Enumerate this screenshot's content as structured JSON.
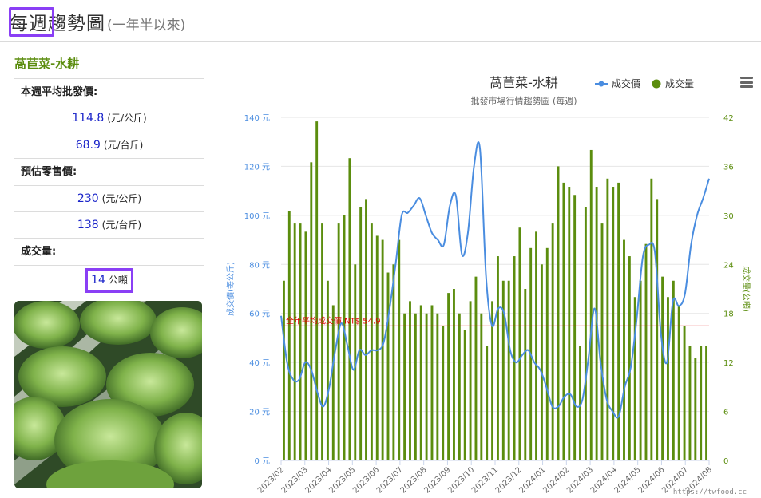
{
  "header": {
    "title": "每週趨勢圖",
    "subtitle": "(一年半以來)"
  },
  "sidebar": {
    "product": "萵苣菜-水耕",
    "wholesale_label": "本週平均批發價:",
    "wholesale_kg": "114.8",
    "wholesale_kg_unit": "(元/公斤)",
    "wholesale_tai": "68.9",
    "wholesale_tai_unit": "(元/台斤)",
    "retail_label": "預估零售價:",
    "retail_kg": "230",
    "retail_kg_unit": "(元/公斤)",
    "retail_tai": "138",
    "retail_tai_unit": "(元/台斤)",
    "volume_label": "成交量:",
    "volume_value": "14",
    "volume_unit": "公噸"
  },
  "watermark": "https://twfood.cc",
  "colors": {
    "price": "#4a8de0",
    "volume": "#5b8d0e",
    "avg_line": "#e00000",
    "highlight": "#8a3ff5"
  },
  "chart_data": {
    "type": "bar+line",
    "title": "萵苣菜-水耕",
    "subtitle": "批發市場行情趨勢圖 (每週)",
    "legend": [
      "成交價",
      "成交量"
    ],
    "legend_position": "top-right",
    "y_left": {
      "label": "成交價(每公斤)",
      "ticks": [
        "0 元",
        "20 元",
        "40 元",
        "60 元",
        "80 元",
        "100 元",
        "120 元",
        "140 元"
      ],
      "range": [
        0,
        140
      ]
    },
    "y_right": {
      "label": "成交量(公噸)",
      "ticks": [
        "0",
        "6",
        "12",
        "18",
        "24",
        "30",
        "36",
        "42"
      ],
      "range": [
        0,
        42
      ]
    },
    "x_ticks": [
      "2023/02",
      "2023/03",
      "2023/04",
      "2023/05",
      "2023/06",
      "2023/07",
      "2023/08",
      "2023/09",
      "2023/10",
      "2023/11",
      "2023/12",
      "2024/01",
      "2024/02",
      "2024/03",
      "2024/04",
      "2024/05",
      "2024/06",
      "2024/07",
      "2024/08"
    ],
    "grid": true,
    "avg_line": {
      "label": "全年平均成交價 NT$ 54.9",
      "value": 54.9
    },
    "series": [
      {
        "name": "成交量",
        "kind": "bar",
        "values": [
          22,
          30.5,
          29,
          29,
          28,
          36.5,
          41.5,
          29,
          22,
          19,
          29,
          30,
          37,
          24,
          31,
          32,
          29,
          27.5,
          27,
          23,
          24,
          27,
          18,
          19.5,
          18,
          19,
          18,
          19,
          18,
          16.5,
          20.5,
          21,
          18,
          16,
          19.5,
          22.5,
          18,
          14,
          19.5,
          25,
          22,
          22,
          25,
          28.5,
          21,
          26,
          28,
          24,
          26,
          29,
          36,
          34,
          33.5,
          32.5,
          14,
          31,
          38,
          33.5,
          29,
          34.5,
          33.5,
          34,
          27,
          25,
          20,
          22,
          26.5,
          34.5,
          32,
          22.5,
          20,
          22,
          19,
          16.5,
          14,
          12.5,
          14,
          14
        ]
      },
      {
        "name": "成交價",
        "kind": "line",
        "values": [
          59,
          40,
          33,
          33,
          40,
          37,
          28,
          22,
          30,
          45,
          56,
          47,
          37,
          45,
          43,
          45,
          45,
          48,
          62,
          80,
          100,
          101,
          104,
          107,
          100,
          93,
          90,
          88,
          104,
          108,
          84,
          93,
          120,
          127,
          75,
          55,
          62,
          60,
          45,
          40,
          43,
          45,
          40,
          37,
          30,
          22,
          22,
          26,
          27,
          22,
          25,
          42,
          62,
          40,
          25,
          20,
          18,
          30,
          38,
          58,
          83,
          88,
          85,
          52,
          40,
          65,
          63,
          68,
          88,
          100,
          107,
          115
        ]
      }
    ]
  }
}
